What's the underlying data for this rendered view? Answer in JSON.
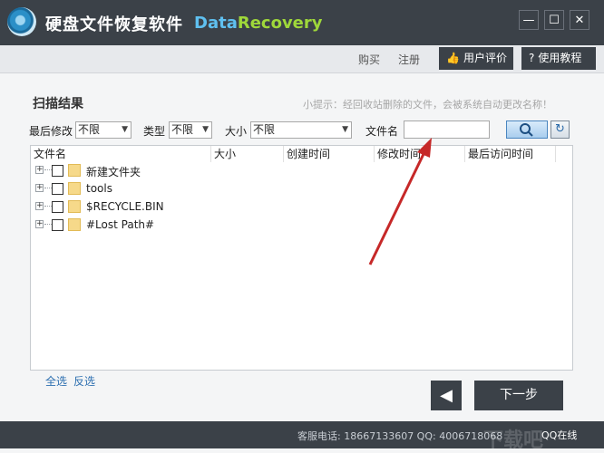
{
  "app": {
    "title": "硬盘文件恢复软件",
    "brand_part1": "Data",
    "brand_part2": "Recovery"
  },
  "window": {
    "minimize": "—",
    "maximize": "☐",
    "close": "✕"
  },
  "toolbar": {
    "buy": "购买",
    "register": "注册",
    "user_review": "用户评价",
    "tutorial": "使用教程"
  },
  "section": {
    "title": "扫描结果",
    "hint": "小提示：经回收站删除的文件，会被系统自动更改名称！"
  },
  "filters": {
    "last_modified_label": "最后修改",
    "last_modified_value": "不限",
    "type_label": "类型",
    "type_value": "不限",
    "size_label": "大小",
    "size_value": "不限",
    "filename_label": "文件名",
    "filename_value": ""
  },
  "table": {
    "columns": [
      "文件名",
      "大小",
      "创建时间",
      "修改时间",
      "最后访问时间"
    ],
    "rows": [
      {
        "name": "新建文件夹"
      },
      {
        "name": "tools"
      },
      {
        "name": "$RECYCLE.BIN"
      },
      {
        "name": "#Lost Path#"
      }
    ]
  },
  "selection": {
    "all": "全选",
    "invert": "反选"
  },
  "nav": {
    "back": "◀",
    "next": "下一步"
  },
  "status": {
    "text": "客服电话: 18667133607 QQ: 4006718068"
  },
  "watermark": {
    "text": "下载吧",
    "badge": "QQ在线"
  },
  "colors": {
    "dark": "#3b4148",
    "accent_blue": "#5fc0f0",
    "accent_green": "#9fd83a",
    "link": "#2d6fb0"
  }
}
